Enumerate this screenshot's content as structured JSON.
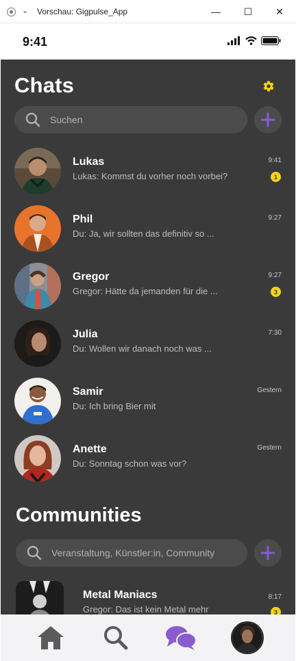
{
  "window": {
    "title": "Vorschau: Gigpulse_App",
    "chevron": "⌄",
    "minimize": "—",
    "maximize": "☐",
    "close": "✕"
  },
  "statusbar": {
    "time": "9:41"
  },
  "chats": {
    "title": "Chats",
    "search_placeholder": "Suchen",
    "items": [
      {
        "name": "Lukas",
        "message": "Lukas: Kommst du vorher noch vorbei?",
        "time": "9:41",
        "badge": "1"
      },
      {
        "name": "Phil",
        "message": "Du: Ja, wir sollten das definitiv so ...",
        "time": "9:27",
        "badge": ""
      },
      {
        "name": "Gregor",
        "message": "Gregor: Hätte da jemanden für die ...",
        "time": "9:27",
        "badge": "3"
      },
      {
        "name": "Julia",
        "message": "Du: Wollen wir danach noch was ...",
        "time": "7:30",
        "badge": ""
      },
      {
        "name": "Samir",
        "message": "Du: Ich bring Bier mit",
        "time": "Gestern",
        "badge": ""
      },
      {
        "name": "Anette",
        "message": "Du: Sonntag schon was vor?",
        "time": "Gestern",
        "badge": ""
      }
    ]
  },
  "communities": {
    "title": "Communities",
    "search_placeholder": "Veranstaltung, Künstler:in, Community",
    "items": [
      {
        "name": "Metal Maniacs",
        "message": "Gregor: Das ist kein Metal mehr",
        "time": "8:17",
        "badge": "3"
      }
    ]
  },
  "colors": {
    "background": "#3a3a3a",
    "accent_purple": "#8a5cd0",
    "badge_yellow": "#f7d21b"
  },
  "icons": [
    "settings-gear-icon",
    "search-icon",
    "plus-icon",
    "home-icon",
    "chat-bubbles-icon"
  ]
}
